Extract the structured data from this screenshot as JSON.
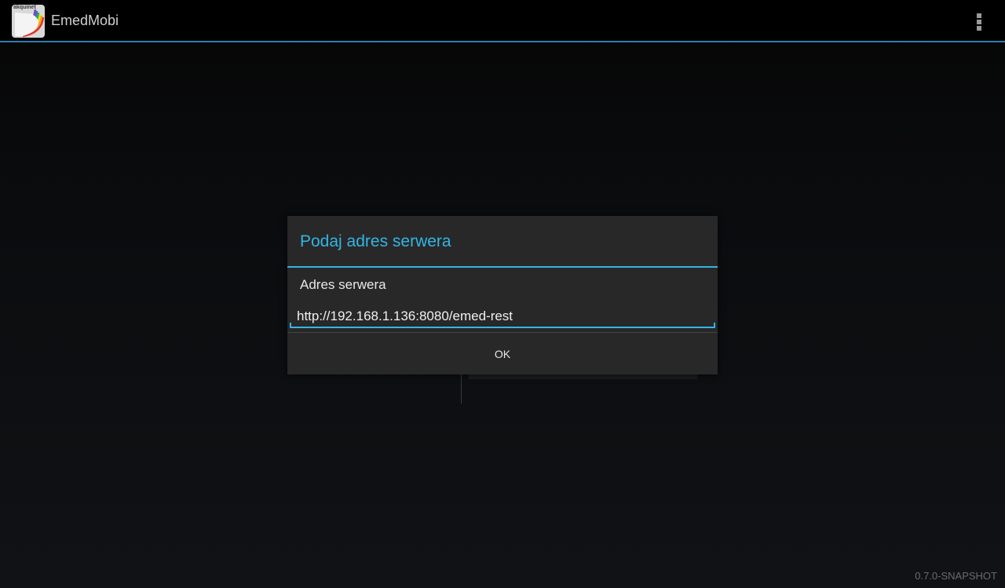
{
  "app": {
    "title": "EmedMobi",
    "icon_name": "emedmobi-logo-icon",
    "icon_brand_text": "akquinet",
    "overflow_icon": "overflow-menu-icon"
  },
  "dialog": {
    "title": "Podaj adres serwera",
    "field_label": "Adres serwera",
    "server_url": "http://192.168.1.136:8080/emed-rest",
    "ok_label": "OK"
  },
  "footer": {
    "version": "0.7.0-SNAPSHOT"
  },
  "colors": {
    "accent": "#33b5e5",
    "action_bar_border": "#2c7fae",
    "dialog_bg": "#282828"
  }
}
